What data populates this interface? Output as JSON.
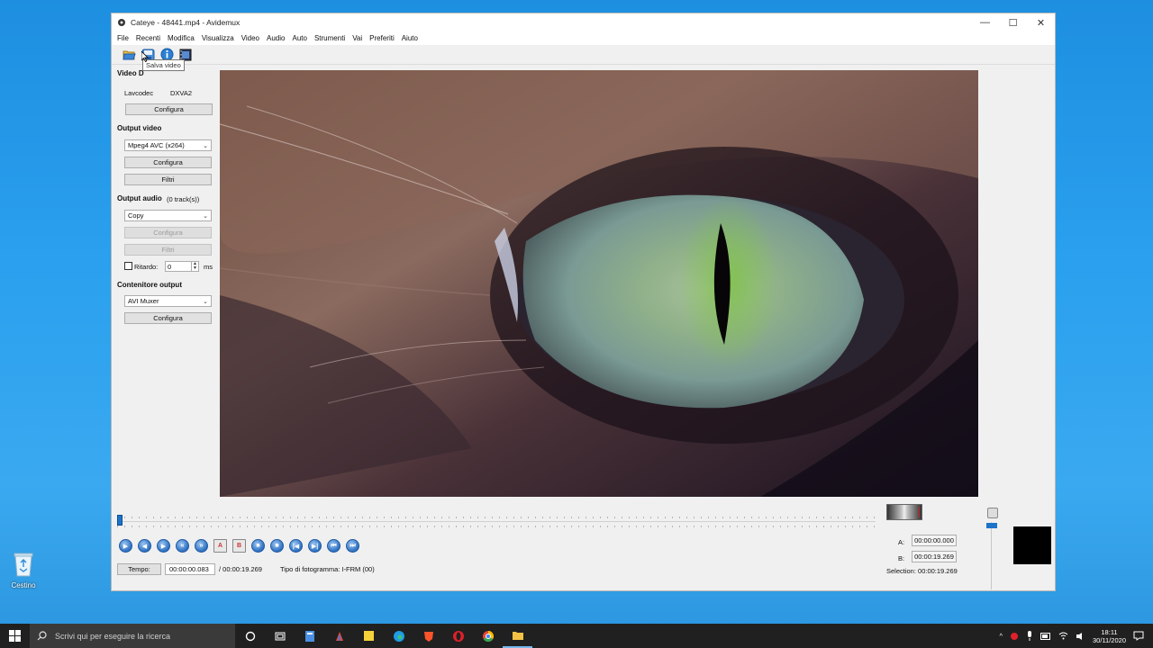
{
  "desktop": {
    "recycle_bin_label": "Cestino"
  },
  "window": {
    "title": "Cateye - 48441.mp4 - Avidemux"
  },
  "menu": [
    "File",
    "Recenti",
    "Modifica",
    "Visualizza",
    "Video",
    "Audio",
    "Auto",
    "Strumenti",
    "Vai",
    "Preferiti",
    "Aiuto"
  ],
  "toolbar": {
    "tooltip": "Salva video"
  },
  "panel": {
    "video_decoder_title": "Video D",
    "decoder_name": "Lavcodec",
    "decoder_accel": "DXVA2",
    "configura": "Configura",
    "output_video_title": "Output video",
    "video_codec": "Mpeg4 AVC (x264)",
    "filtri": "Filtri",
    "output_audio_title": "Output audio",
    "audio_tracks": "(0 track(s))",
    "audio_codec": "Copy",
    "ritardo_label": "Ritardo:",
    "ritardo_value": "0",
    "ritardo_unit": "ms",
    "container_title": "Contenitore output",
    "container": "AVI Muxer"
  },
  "status": {
    "tempo_label": "Tempo:",
    "current_time": "00:00:00.083",
    "total_time": "/ 00:00:19.269",
    "frame_type": "Tipo di fotogramma:  I-FRM (00)",
    "a_label": "A:",
    "a_value": "00:00:00.000",
    "b_label": "B:",
    "b_value": "00:00:19.269",
    "selection": "Selection: 00:00:19.269"
  },
  "taskbar": {
    "search_placeholder": "Scrivi qui per eseguire la ricerca",
    "time": "18:11",
    "date": "30/11/2020"
  },
  "colors": {
    "accent": "#1c73c9",
    "taskbar": "#202020"
  }
}
